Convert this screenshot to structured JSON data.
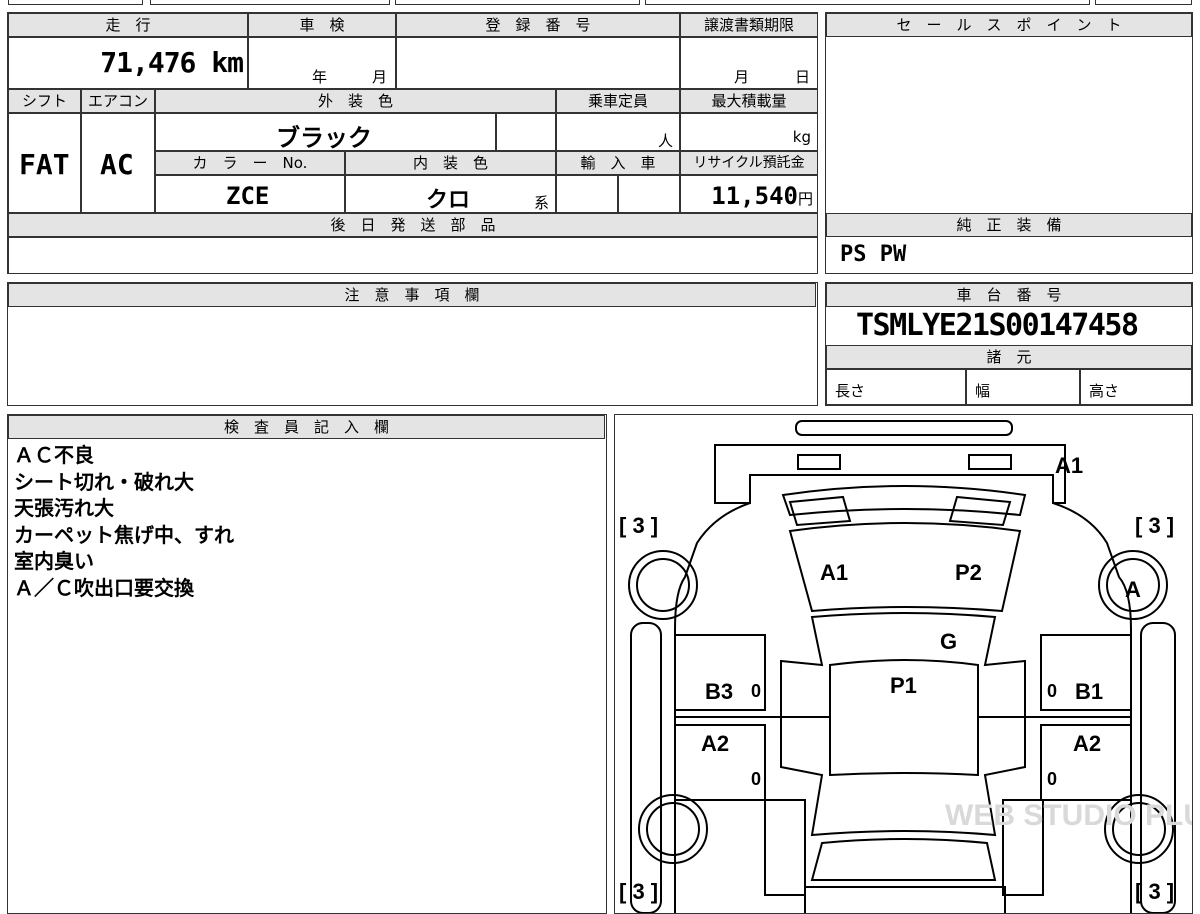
{
  "top": {
    "mileage_label": "走　行",
    "mileage_value": "71,476",
    "mileage_unit": "km",
    "shaken_label": "車　検",
    "shaken_year": "年",
    "shaken_month": "月",
    "reg_label": "登　録　番　号",
    "transfer_label": "譲渡書類期限",
    "transfer_month": "月",
    "transfer_day": "日",
    "shift_label": "シフト",
    "ac_label": "エアコン",
    "ext_color_label": "外　装　色",
    "capacity_label": "乗車定員",
    "load_label": "最大積載量",
    "shift_value": "FAT",
    "ac_value": "AC",
    "ext_color_value": "ブラック",
    "capacity_unit": "人",
    "load_unit": "kg",
    "color_no_label": "カ　ラ　ー　No.",
    "int_color_label": "内　装　色",
    "import_label": "輸　入　車",
    "recycle_label": "リサイクル預託金",
    "color_no_value": "ZCE",
    "int_color_value": "クロ",
    "int_color_suffix": "系",
    "recycle_value": "11,540",
    "recycle_unit": "円",
    "later_parts_label": "後　日　発　送　部　品"
  },
  "sales": {
    "label": "セ　ー　ル　ス　ポ　イ　ン　ト"
  },
  "equipment": {
    "label": "純　正　装　備",
    "value": "PS PW"
  },
  "notes": {
    "label": "注　意　事　項　欄"
  },
  "chassis": {
    "label": "車　台　番　号",
    "value": "TSMLYE21S00147458",
    "specs_label": "諸　元",
    "length_label": "長さ",
    "width_label": "幅",
    "height_label": "高さ"
  },
  "inspector": {
    "label": "検　査　員　記　入　欄",
    "lines": [
      "ＡＣ不良",
      "シート切れ・破れ大",
      "天張汚れ大",
      "カーペット焦げ中、すれ",
      "室内臭い",
      "Ａ／Ｃ吹出口要交換"
    ]
  },
  "diagram": {
    "tire_fl": "[ 3 ]",
    "tire_fr": "[ 3 ]",
    "tire_rl": "[ 3 ]",
    "tire_rr": "[ 3 ]",
    "marks": {
      "dashboard": "A1",
      "seat_left_front": "A1",
      "seat_right_front": "P2",
      "console": "G",
      "floor": "P1",
      "right_wheel": "A",
      "door_left_front": "B3",
      "door_right_front": "B1",
      "door_left_rear": "A2",
      "door_right_rear": "A2",
      "zero_lf": "0",
      "zero_rf": "0",
      "zero_lr": "0",
      "zero_rr": "0"
    },
    "watermark": "WEB STUDIO PLUS"
  }
}
